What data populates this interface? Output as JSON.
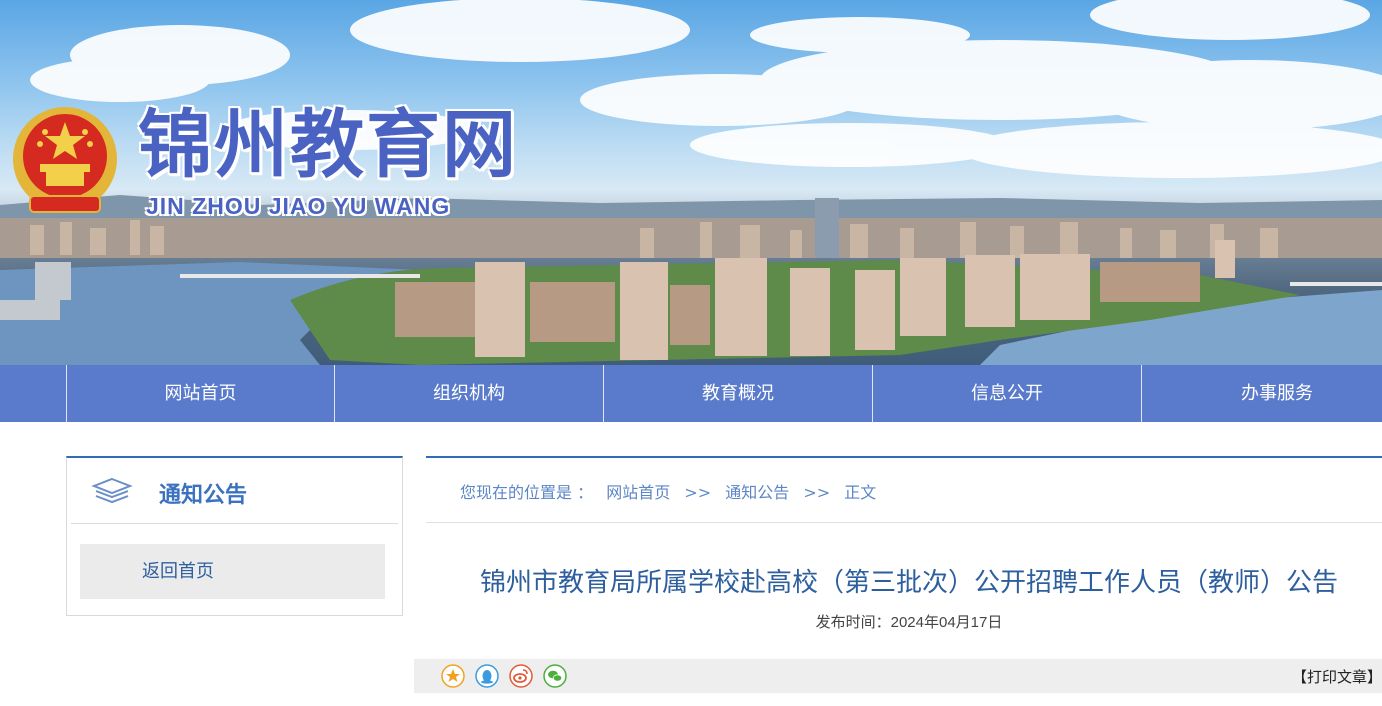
{
  "header": {
    "site_title": "锦州教育网",
    "site_subtitle": "JIN ZHOU JIAO YU WANG"
  },
  "nav": {
    "items": [
      {
        "label": "网站首页"
      },
      {
        "label": "组织机构"
      },
      {
        "label": "教育概况"
      },
      {
        "label": "信息公开"
      },
      {
        "label": "办事服务"
      }
    ]
  },
  "sidebar": {
    "title": "通知公告",
    "back_home": "返回首页"
  },
  "breadcrumb": {
    "prefix": "您现在的位置是 ：",
    "items": [
      "网站首页",
      "通知公告",
      "正文"
    ],
    "separator": ">>"
  },
  "article": {
    "title": "锦州市教育局所属学校赴高校（第三批次）公开招聘工作人员（教师）公告",
    "publish_label": "发布时间：",
    "publish_date": "2024年04月17日"
  },
  "share": {
    "icons": [
      "favorite-star-icon",
      "qq-icon",
      "weibo-icon",
      "wechat-icon"
    ],
    "print_label": "【打印文章】"
  },
  "colors": {
    "nav_bg": "#5a7bcc",
    "accent": "#2f6db5",
    "title_text": "#2d5e9e",
    "brand_title": "#4a63c3"
  }
}
